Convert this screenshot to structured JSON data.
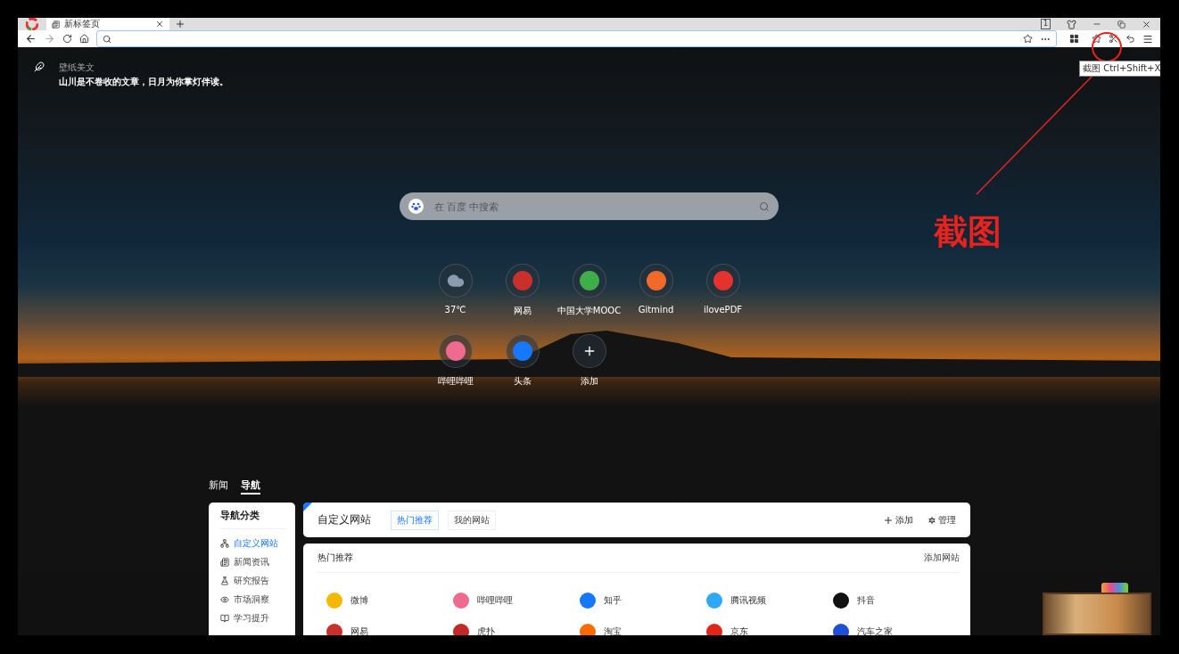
{
  "browser": {
    "tabs": [
      {
        "title": "新标签页",
        "selected": true
      }
    ],
    "tab_count": "1",
    "tooltip": "截图 Ctrl+Shift+X"
  },
  "wallpaper_quote": {
    "source": "壁纸美文",
    "text": "山川是不卷收的文章，日月为你掌灯伴读。"
  },
  "search": {
    "placeholder": "在 百度 中搜索"
  },
  "shortcuts": [
    {
      "label": "37℃",
      "kind": "weather",
      "color": "#8a9bad"
    },
    {
      "label": "网易",
      "kind": "site",
      "color": "#c9302c"
    },
    {
      "label": "中国大学MOOC",
      "kind": "site",
      "color": "#3fae49"
    },
    {
      "label": "Gitmind",
      "kind": "site",
      "color": "#f26a2a"
    },
    {
      "label": "ilovePDF",
      "kind": "site",
      "color": "#e5322d"
    },
    {
      "label": "哔哩哔哩",
      "kind": "site",
      "color": "#ef6a8f"
    },
    {
      "label": "头条",
      "kind": "site",
      "color": "#1677ff"
    },
    {
      "label": "添加",
      "kind": "add"
    }
  ],
  "feed_tabs": [
    {
      "label": "新闻",
      "selected": false
    },
    {
      "label": "导航",
      "selected": true
    }
  ],
  "sidebar": {
    "title": "导航分类",
    "items": [
      {
        "label": "自定义网站",
        "selected": true
      },
      {
        "label": "新闻资讯",
        "selected": false
      },
      {
        "label": "研究报告",
        "selected": false
      },
      {
        "label": "市场洞察",
        "selected": false
      },
      {
        "label": "学习提升",
        "selected": false
      }
    ]
  },
  "header": {
    "title": "自定义网站",
    "tabs": [
      {
        "label": "热门推荐",
        "selected": true
      },
      {
        "label": "我的网站",
        "selected": false
      }
    ],
    "actions": [
      {
        "label": "添加",
        "kind": "add"
      },
      {
        "label": "管理",
        "kind": "manage"
      }
    ]
  },
  "hot": {
    "title": "热门推荐",
    "add_link": "添加网站",
    "sites": [
      {
        "name": "微博",
        "color": "#f5b800"
      },
      {
        "name": "哔哩哔哩",
        "color": "#ef6a8f"
      },
      {
        "name": "知乎",
        "color": "#1677ff"
      },
      {
        "name": "腾讯视频",
        "color": "#2fa8f5"
      },
      {
        "name": "抖音",
        "color": "#111111"
      },
      {
        "name": "网易",
        "color": "#c9302c"
      },
      {
        "name": "虎扑",
        "color": "#c62828"
      },
      {
        "name": "淘宝",
        "color": "#ff6a00"
      },
      {
        "name": "京东",
        "color": "#e1251b"
      },
      {
        "name": "汽车之家",
        "color": "#1e4fd8"
      }
    ]
  },
  "annotation": {
    "label": "截图"
  }
}
